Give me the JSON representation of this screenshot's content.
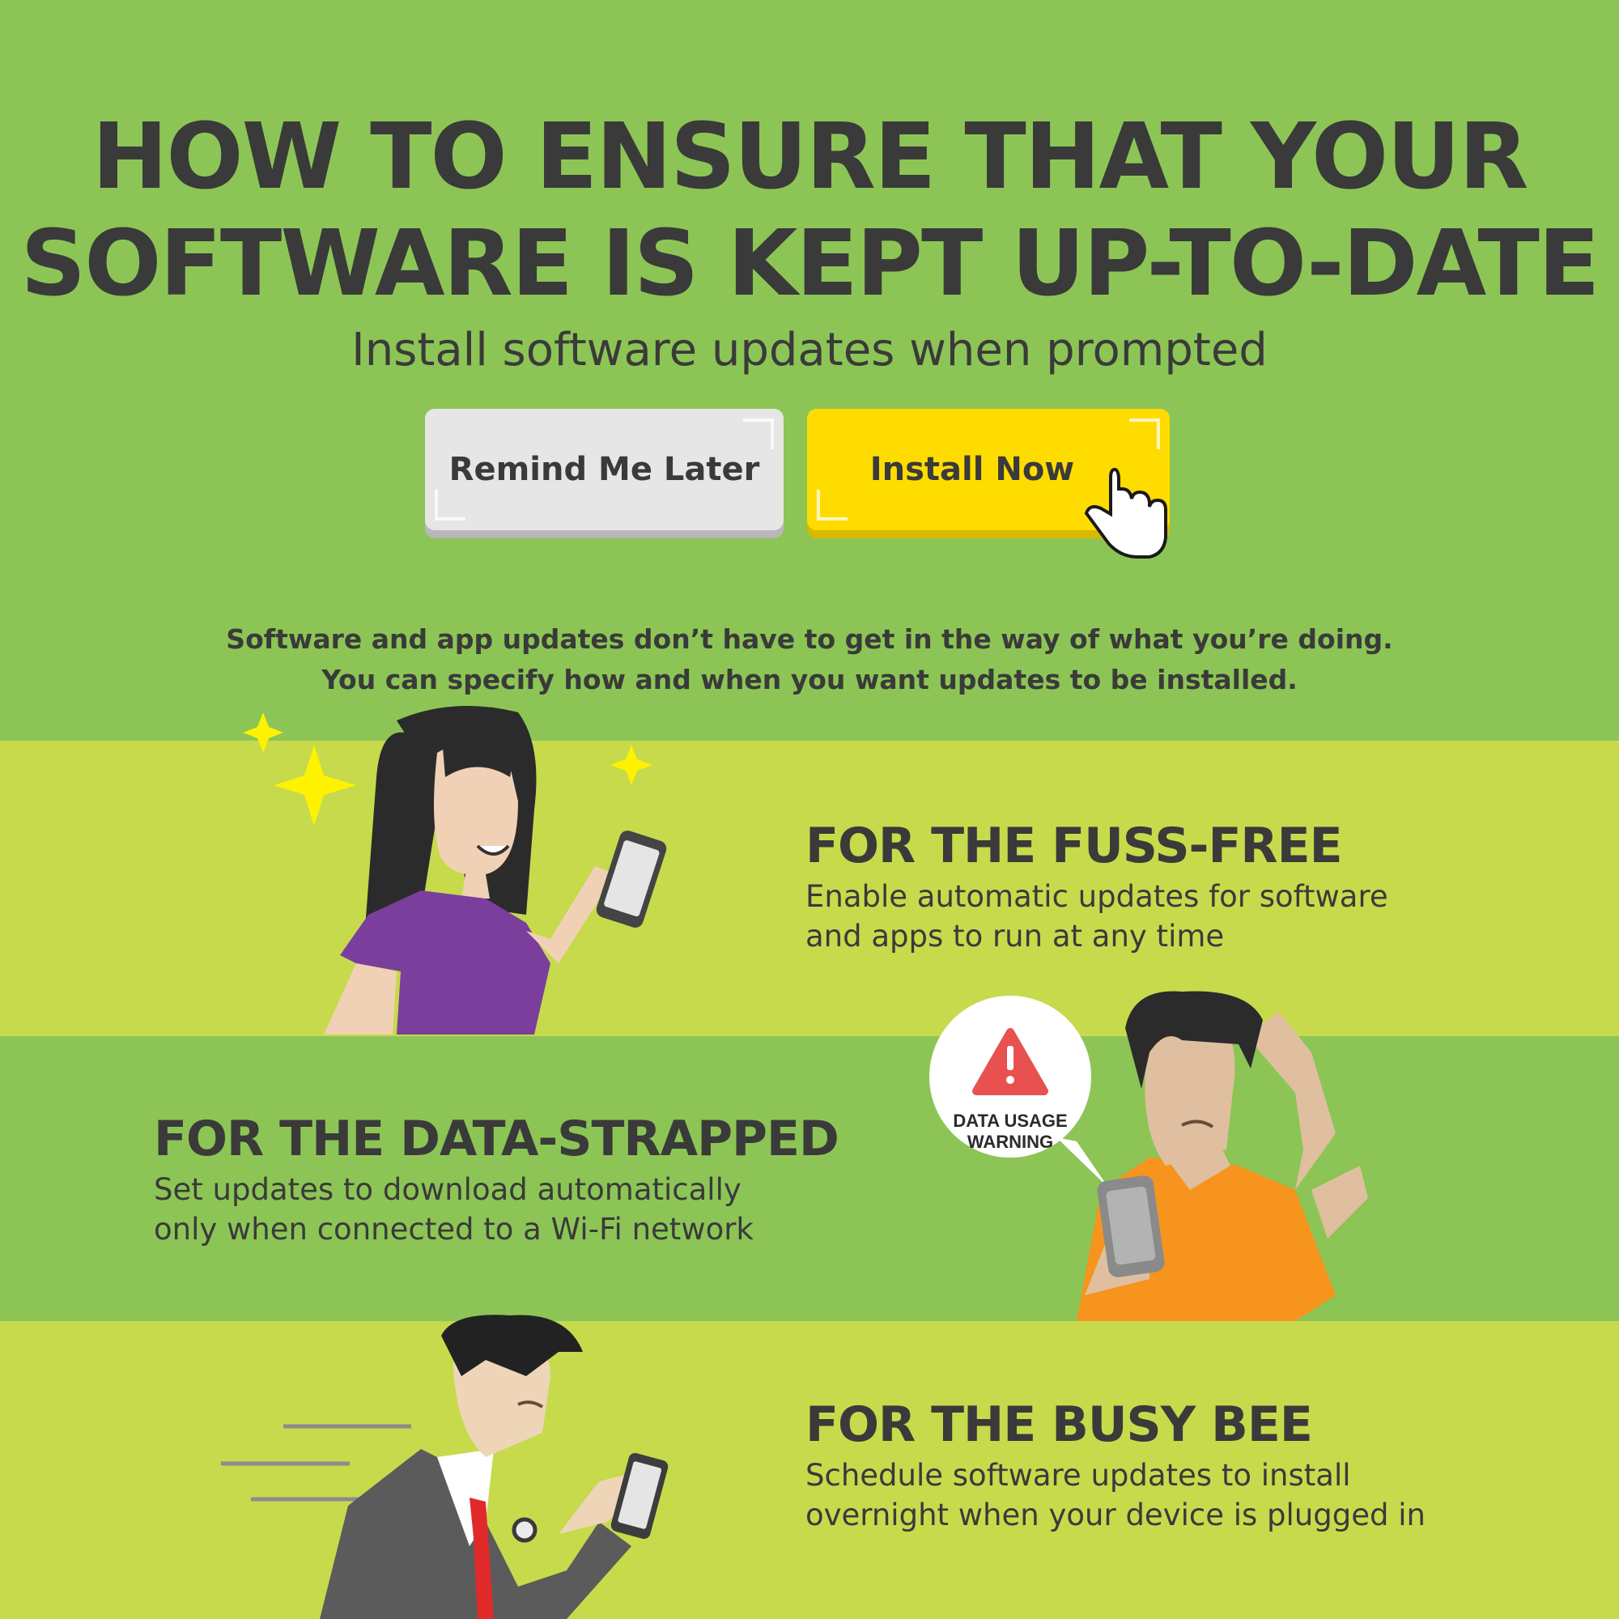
{
  "header": {
    "title_line1": "HOW TO ENSURE THAT YOUR",
    "title_line2": "SOFTWARE IS KEPT UP-TO-DATE",
    "subtitle": "Install software updates when prompted"
  },
  "buttons": {
    "remind_label": "Remind Me Later",
    "install_label": "Install Now"
  },
  "intro": {
    "line1": "Software and app updates don’t have to get in the way of what you’re doing.",
    "line2": "You can specify how and when you want updates to be installed."
  },
  "sections": [
    {
      "heading": "FOR THE FUSS-FREE",
      "line1": "Enable automatic updates for software",
      "line2": "and apps to run at any time"
    },
    {
      "heading": "FOR THE DATA-STRAPPED",
      "line1": "Set updates to download automatically",
      "line2": "only when connected to a Wi-Fi network"
    },
    {
      "heading": "FOR THE BUSY BEE",
      "line1": "Schedule software updates to install",
      "line2": "overnight when your device is plugged in"
    }
  ],
  "warning_bubble": {
    "line1": "DATA USAGE",
    "line2": "WARNING"
  },
  "colors": {
    "dark_green_band": "#8cc555",
    "light_green_band": "#c7da4c",
    "install_button": "#ffdc00",
    "remind_button": "#e6e6e6",
    "text": "#3a3a3a",
    "warning_red": "#e8514f"
  }
}
